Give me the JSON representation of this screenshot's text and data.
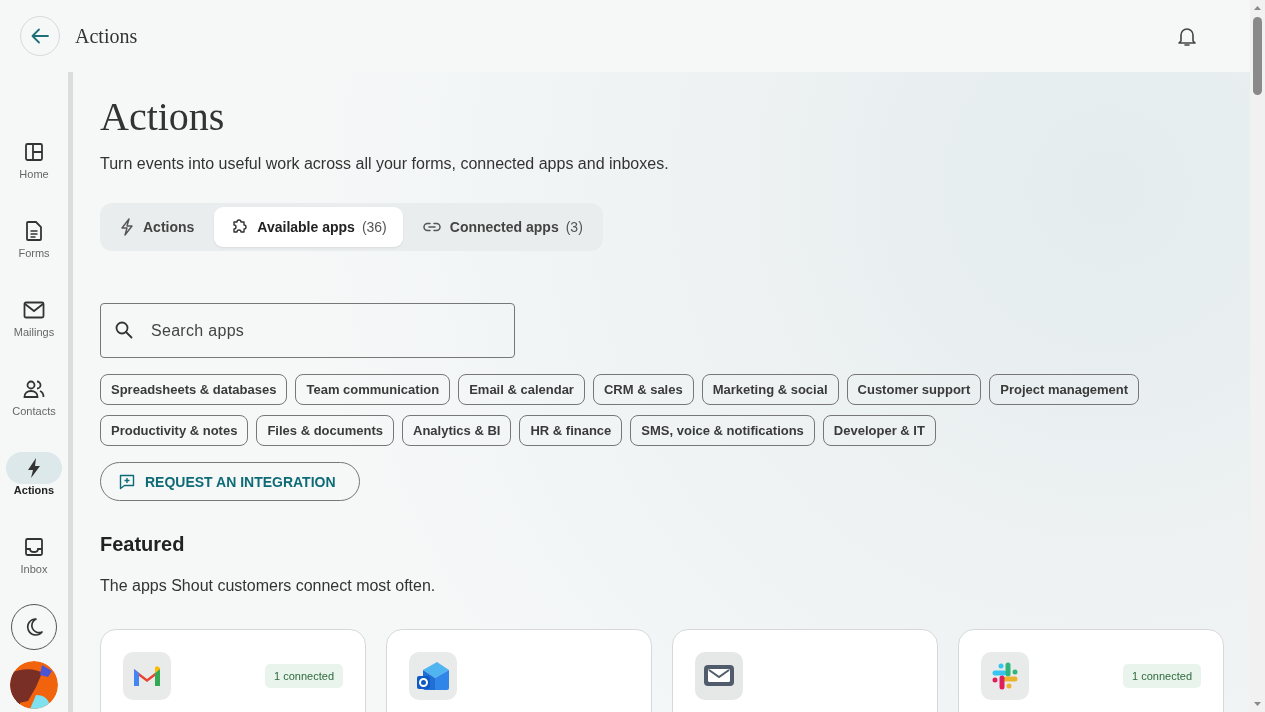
{
  "header": {
    "title": "Actions"
  },
  "sidebar": {
    "items": [
      {
        "label": "Home",
        "kind": "home",
        "selected": false
      },
      {
        "label": "Forms",
        "kind": "forms",
        "selected": false
      },
      {
        "label": "Mailings",
        "kind": "mailings",
        "selected": false
      },
      {
        "label": "Contacts",
        "kind": "contacts",
        "selected": false
      },
      {
        "label": "Actions",
        "kind": "actions",
        "selected": true
      },
      {
        "label": "Inbox",
        "kind": "inbox",
        "selected": false
      }
    ]
  },
  "page": {
    "title": "Actions",
    "subtitle": "Turn events into useful work across all your forms, connected apps and inboxes."
  },
  "tabs": [
    {
      "label": "Actions",
      "kind": "bolt",
      "selected": false
    },
    {
      "label": "Available apps",
      "count": "(36)",
      "kind": "puzzle",
      "selected": true
    },
    {
      "label": "Connected apps",
      "count": "(3)",
      "kind": "link",
      "selected": false
    }
  ],
  "search": {
    "placeholder": "Search apps"
  },
  "categories": [
    "Spreadsheets & databases",
    "Team communication",
    "Email & calendar",
    "CRM & sales",
    "Marketing & social",
    "Customer support",
    "Project management",
    "Productivity & notes",
    "Files & documents",
    "Analytics & BI",
    "HR & finance",
    "SMS, voice & notifications",
    "Developer & IT"
  ],
  "request_button": {
    "label": "REQUEST AN INTEGRATION"
  },
  "featured": {
    "title": "Featured",
    "subtitle": "The apps Shout customers connect most often.",
    "cards": [
      {
        "kind": "gmail",
        "badge": "1 connected"
      },
      {
        "kind": "outlook"
      },
      {
        "kind": "email"
      },
      {
        "kind": "slack",
        "badge": "1 connected"
      }
    ]
  }
}
